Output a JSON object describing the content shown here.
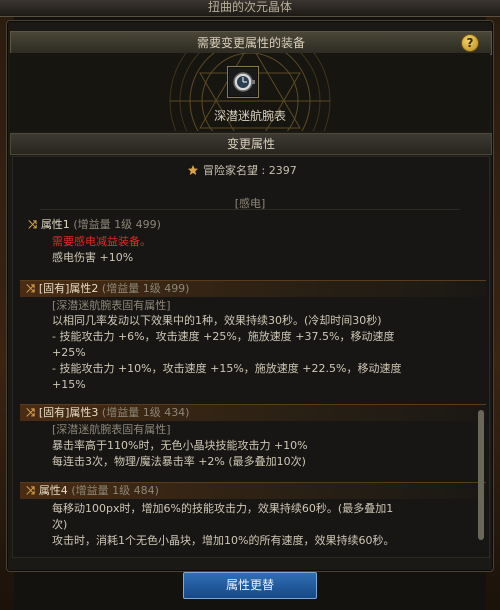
{
  "window": {
    "title": "扭曲的次元晶体"
  },
  "header": {
    "title": "需要变更属性的装备",
    "help_label": "?"
  },
  "item": {
    "name": "深潜迷航腕表"
  },
  "change_bar": {
    "title": "变更属性"
  },
  "fame": {
    "label": "冒险家名望",
    "value": ": 2397"
  },
  "element_label": "[感电]",
  "attr1": {
    "title": "属性1",
    "level": "(增益量 1级 499)",
    "warning": "需要感电减益装备。",
    "desc": "感电伤害 +10%"
  },
  "attr2": {
    "title": "[固有]属性2",
    "level": "(增益量 1级 499)",
    "sub": "[深潜迷航腕表固有属性]",
    "lines": [
      "以相同几率发动以下效果中的1种，效果持续30秒。(冷却时间30秒)",
      "- 技能攻击力 +6%，攻击速度 +25%，施放速度 +37.5%，移动速度",
      "+25%",
      "- 技能攻击力 +10%，攻击速度 +15%，施放速度 +22.5%，移动速度",
      "+15%"
    ]
  },
  "attr3": {
    "title": "[固有]属性3",
    "level": "(增益量 1级 434)",
    "sub": "[深潜迷航腕表固有属性]",
    "lines": [
      "暴击率高于110%时，无色小晶块技能攻击力 +10%",
      "每连击3次，物理/魔法暴击率 +2% (最多叠加10次)"
    ]
  },
  "attr4": {
    "title": "属性4",
    "level": "(增益量 1级 484)",
    "lines": [
      "每移动100px时，增加6%的技能攻击力，效果持续60秒。(最多叠加1",
      "次)",
      "攻击时，消耗1个无色小晶块，增加10%的所有速度，效果持续60秒。"
    ]
  },
  "bottom_button": {
    "label": "属性更替"
  },
  "colors": {
    "accent_gold": "#d9a347",
    "warning_red": "#e0282a",
    "button_blue": "#2f6fb4"
  },
  "icons": [
    "shuffle-icon",
    "fame-icon",
    "help-icon",
    "watch-icon"
  ]
}
